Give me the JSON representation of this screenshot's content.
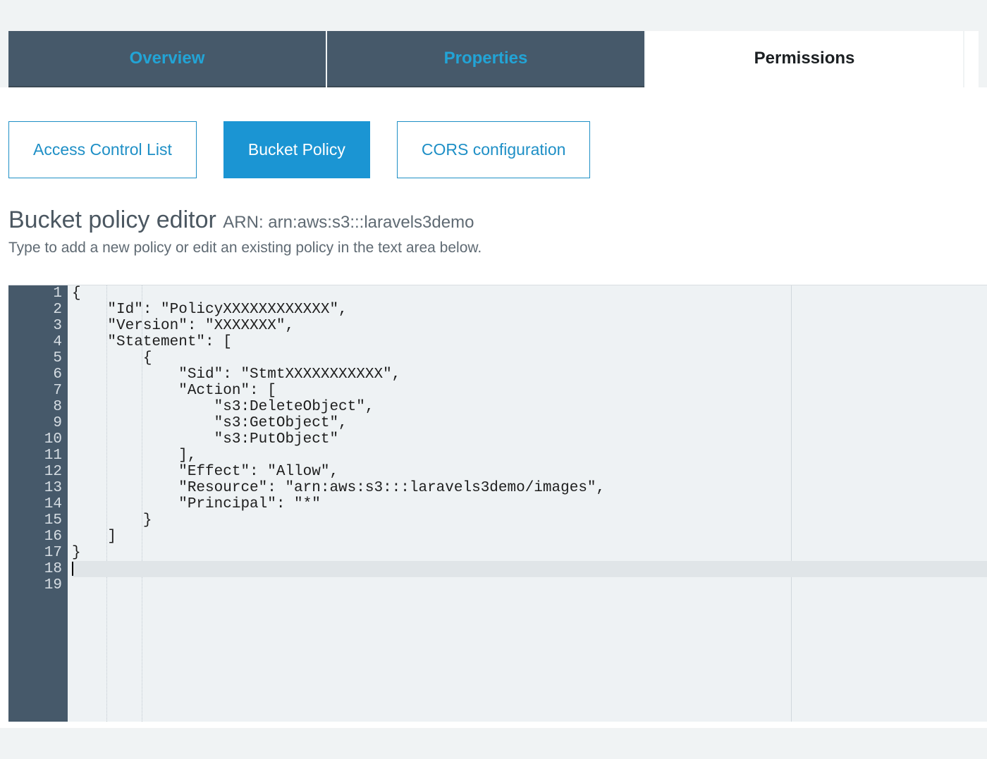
{
  "tabs": {
    "overview": "Overview",
    "properties": "Properties",
    "permissions": "Permissions"
  },
  "subtabs": {
    "acl": "Access Control List",
    "policy": "Bucket Policy",
    "cors": "CORS configuration"
  },
  "editor": {
    "title": "Bucket policy editor ",
    "arn_label": "ARN: arn:aws:s3:::laravels3demo",
    "subtext": "Type to add a new policy or edit an existing policy in the text area below."
  },
  "code": {
    "line_count": 19,
    "cursor_line": 18,
    "lines": [
      "{",
      "    \"Id\": \"PolicyXXXXXXXXXXXX\",",
      "    \"Version\": \"XXXXXXX\",",
      "    \"Statement\": [",
      "        {",
      "            \"Sid\": \"StmtXXXXXXXXXXX\",",
      "            \"Action\": [",
      "                \"s3:DeleteObject\",",
      "                \"s3:GetObject\",",
      "                \"s3:PutObject\"",
      "            ],",
      "            \"Effect\": \"Allow\",",
      "            \"Resource\": \"arn:aws:s3:::laravels3demo/images\",",
      "            \"Principal\": \"*\"",
      "        }",
      "    ]",
      "}",
      "",
      ""
    ]
  }
}
